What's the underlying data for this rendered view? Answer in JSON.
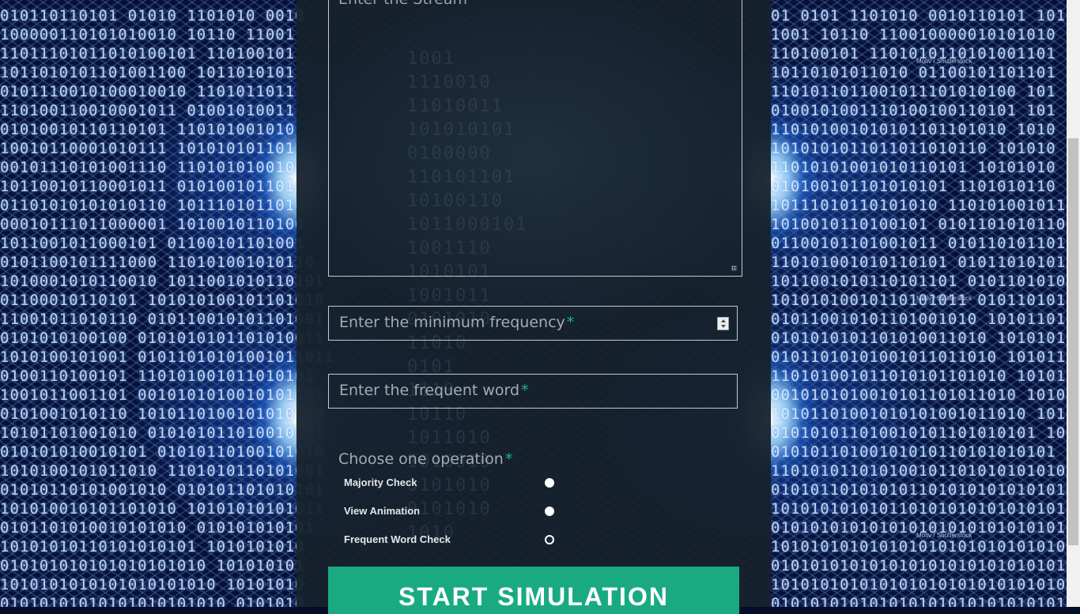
{
  "background": {
    "credits": [
      "Motiv / Shutterstock",
      "Motiv / Shutterstock",
      "Motiv / Shutterstock"
    ]
  },
  "form": {
    "stream_placeholder": "Enter the Stream",
    "min_frequency_placeholder": "Enter the minimum frequency",
    "frequent_word_placeholder": "Enter the frequent word",
    "required_mark": "*",
    "operation_title": "Choose one operation",
    "operations": [
      {
        "label": "Majority Check",
        "selected": false
      },
      {
        "label": "View Animation",
        "selected": false
      },
      {
        "label": "Frequent Word Check",
        "selected": true
      }
    ],
    "submit_label": "START SIMULATION"
  },
  "colors": {
    "accent": "#1aaa82",
    "required": "#20b586",
    "panel": "#16222c"
  },
  "icons": [
    "spinner-icon",
    "resize-grip-icon"
  ]
}
